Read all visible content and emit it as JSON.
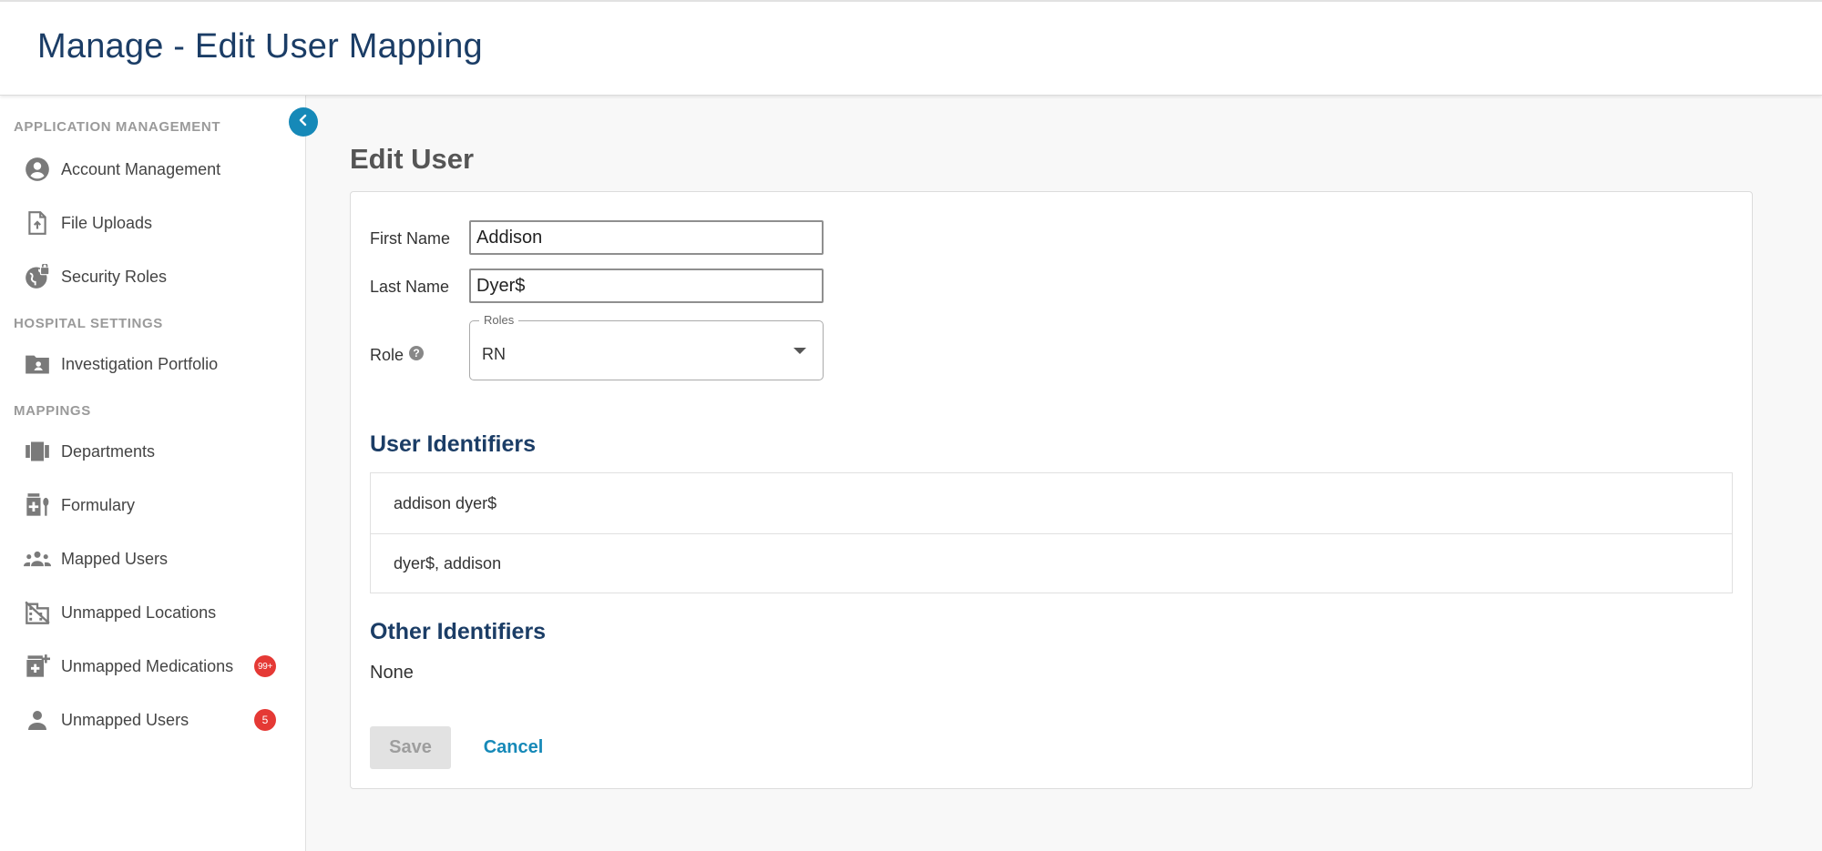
{
  "header": {
    "title": "Manage - Edit User Mapping"
  },
  "sidebar": {
    "collapse_icon": "chevron-left-icon",
    "sections": [
      {
        "label": "APPLICATION MANAGEMENT"
      },
      {
        "label": "HOSPITAL SETTINGS"
      },
      {
        "label": "MAPPINGS"
      }
    ],
    "items": [
      {
        "label": "Account Management",
        "icon": "account-circle-icon"
      },
      {
        "label": "File Uploads",
        "icon": "file-upload-icon"
      },
      {
        "label": "Security Roles",
        "icon": "globe-lock-icon"
      },
      {
        "label": "Investigation Portfolio",
        "icon": "folder-shared-icon"
      },
      {
        "label": "Departments",
        "icon": "view-carousel-icon"
      },
      {
        "label": "Formulary",
        "icon": "medication-icon"
      },
      {
        "label": "Mapped Users",
        "icon": "people-icon"
      },
      {
        "label": "Unmapped Locations",
        "icon": "domain-disabled-icon"
      },
      {
        "label": "Unmapped Medications",
        "icon": "medication-add-icon",
        "badge": "99+"
      },
      {
        "label": "Unmapped Users",
        "icon": "person-icon",
        "badge": "5"
      }
    ],
    "badge_color": "#e53935"
  },
  "main": {
    "title": "Edit User",
    "form": {
      "first_name_label": "First Name",
      "first_name_value": "Addison",
      "last_name_label": "Last Name",
      "last_name_value": "Dyer$",
      "role_label": "Role",
      "role_help_icon": "help-circle-icon",
      "role_select_legend": "Roles",
      "role_select_value": "RN"
    },
    "user_identifiers": {
      "heading": "User Identifiers",
      "items": [
        "addison dyer$",
        "dyer$, addison"
      ]
    },
    "other_identifiers": {
      "heading": "Other Identifiers",
      "value": "None"
    },
    "actions": {
      "save_label": "Save",
      "cancel_label": "Cancel"
    }
  },
  "colors": {
    "title": "#1b3d66",
    "accent": "#1689b8"
  }
}
